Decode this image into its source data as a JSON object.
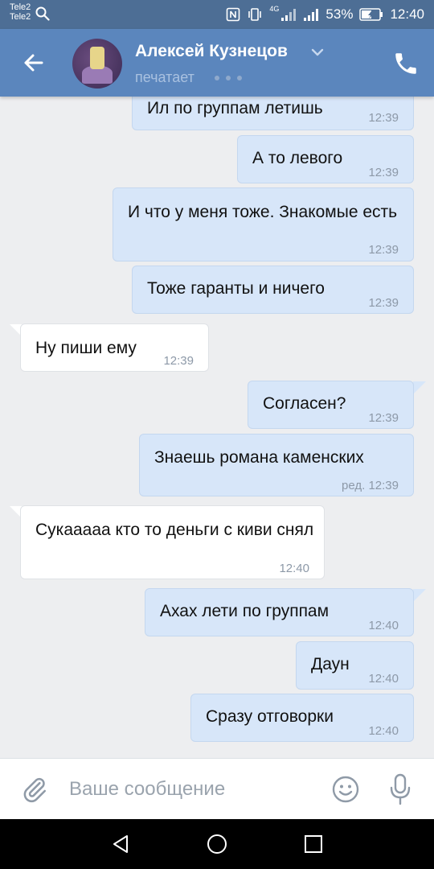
{
  "status_bar": {
    "carrier1": "Tele2",
    "carrier2": "Tele2",
    "network": "4G",
    "battery": "53%",
    "time": "12:40",
    "icons": [
      "search-icon",
      "nfc-icon",
      "vibrate-icon",
      "signal-icon",
      "battery-icon"
    ]
  },
  "header": {
    "contact_name": "Алексей Кузнецов",
    "status": "печатает",
    "colors": {
      "header_bg": "#5b86bd",
      "statusbar_bg": "#4d6e95"
    }
  },
  "messages": [
    {
      "dir": "out",
      "text": "Ил  по группам летишь",
      "time": "12:39"
    },
    {
      "dir": "out",
      "text": "А то левого",
      "time": "12:39"
    },
    {
      "dir": "out",
      "text": "И что у  меня тоже. Знакомые есть",
      "time": "12:39"
    },
    {
      "dir": "out",
      "text": "Тоже гаранты и ничего",
      "time": "12:39"
    },
    {
      "dir": "in",
      "text": "Ну пиши ему",
      "time": "12:39"
    },
    {
      "dir": "out",
      "text": "Согласен?",
      "time": "12:39"
    },
    {
      "dir": "out",
      "text": "Знаешь романа каменских",
      "time": "ред. 12:39"
    },
    {
      "dir": "in",
      "text": "Сукааааа кто то деньги с киви снял",
      "time": "12:40"
    },
    {
      "dir": "out",
      "text": "Ахах лети по группам",
      "time": "12:40"
    },
    {
      "dir": "out",
      "text": "Даун",
      "time": "12:40"
    },
    {
      "dir": "out",
      "text": "Сразу отговорки",
      "time": "12:40"
    }
  ],
  "composer": {
    "placeholder": "Ваше сообщение",
    "value": ""
  },
  "colors": {
    "outgoing_bubble": "#d7e6f9",
    "incoming_bubble": "#ffffff",
    "chat_bg": "#edeef0"
  }
}
